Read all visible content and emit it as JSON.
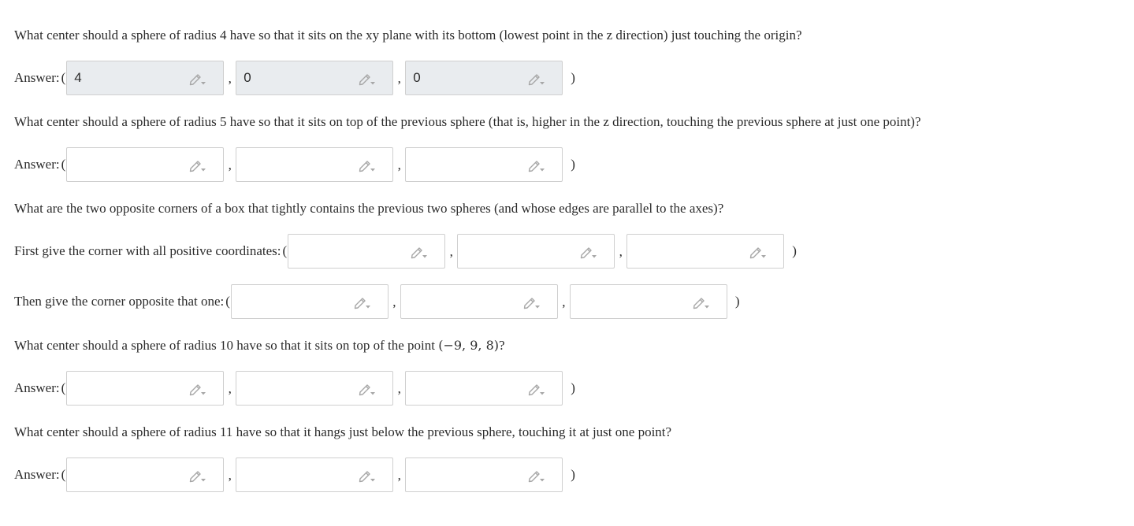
{
  "questions": [
    {
      "prompt": "What center should a sphere of radius 4 have so that it sits on the xy plane with its bottom (lowest point in the z direction) just touching the origin?",
      "rows": [
        {
          "label": "Answer:",
          "values": [
            "4",
            "0",
            "0"
          ]
        }
      ]
    },
    {
      "prompt": "What center should a sphere of radius 5 have so that it sits on top of the previous sphere (that is, higher in the z direction, touching the previous sphere at just one point)?",
      "rows": [
        {
          "label": "Answer:",
          "values": [
            "",
            "",
            ""
          ]
        }
      ]
    },
    {
      "prompt": "What are the two opposite corners of a box that tightly contains the previous two spheres (and whose edges are parallel to the axes)?",
      "rows": [
        {
          "label": "First give the corner with all positive coordinates:",
          "values": [
            "",
            "",
            ""
          ]
        },
        {
          "label": "Then give the corner opposite that one:",
          "values": [
            "",
            "",
            ""
          ]
        }
      ]
    },
    {
      "prompt_before": "What center should a sphere of radius 10 have so that it sits on top of the point",
      "prompt_math": "(−9, 9, 8)",
      "prompt_after": "?",
      "rows": [
        {
          "label": "Answer:",
          "values": [
            "",
            "",
            ""
          ]
        }
      ]
    },
    {
      "prompt": "What center should a sphere of radius 11 have so that it hangs just below the previous sphere, touching it at just one point?",
      "rows": [
        {
          "label": "Answer:",
          "values": [
            "",
            "",
            ""
          ]
        }
      ]
    }
  ],
  "punctuation": {
    "open": "(",
    "comma": ",",
    "close": ")"
  },
  "icons": {
    "field_edit": "pencil-dropdown-icon"
  },
  "colors": {
    "filled_field_bg": "#e9ecef",
    "field_border": "#cfcfcf",
    "icon": "#a7a7a7"
  }
}
